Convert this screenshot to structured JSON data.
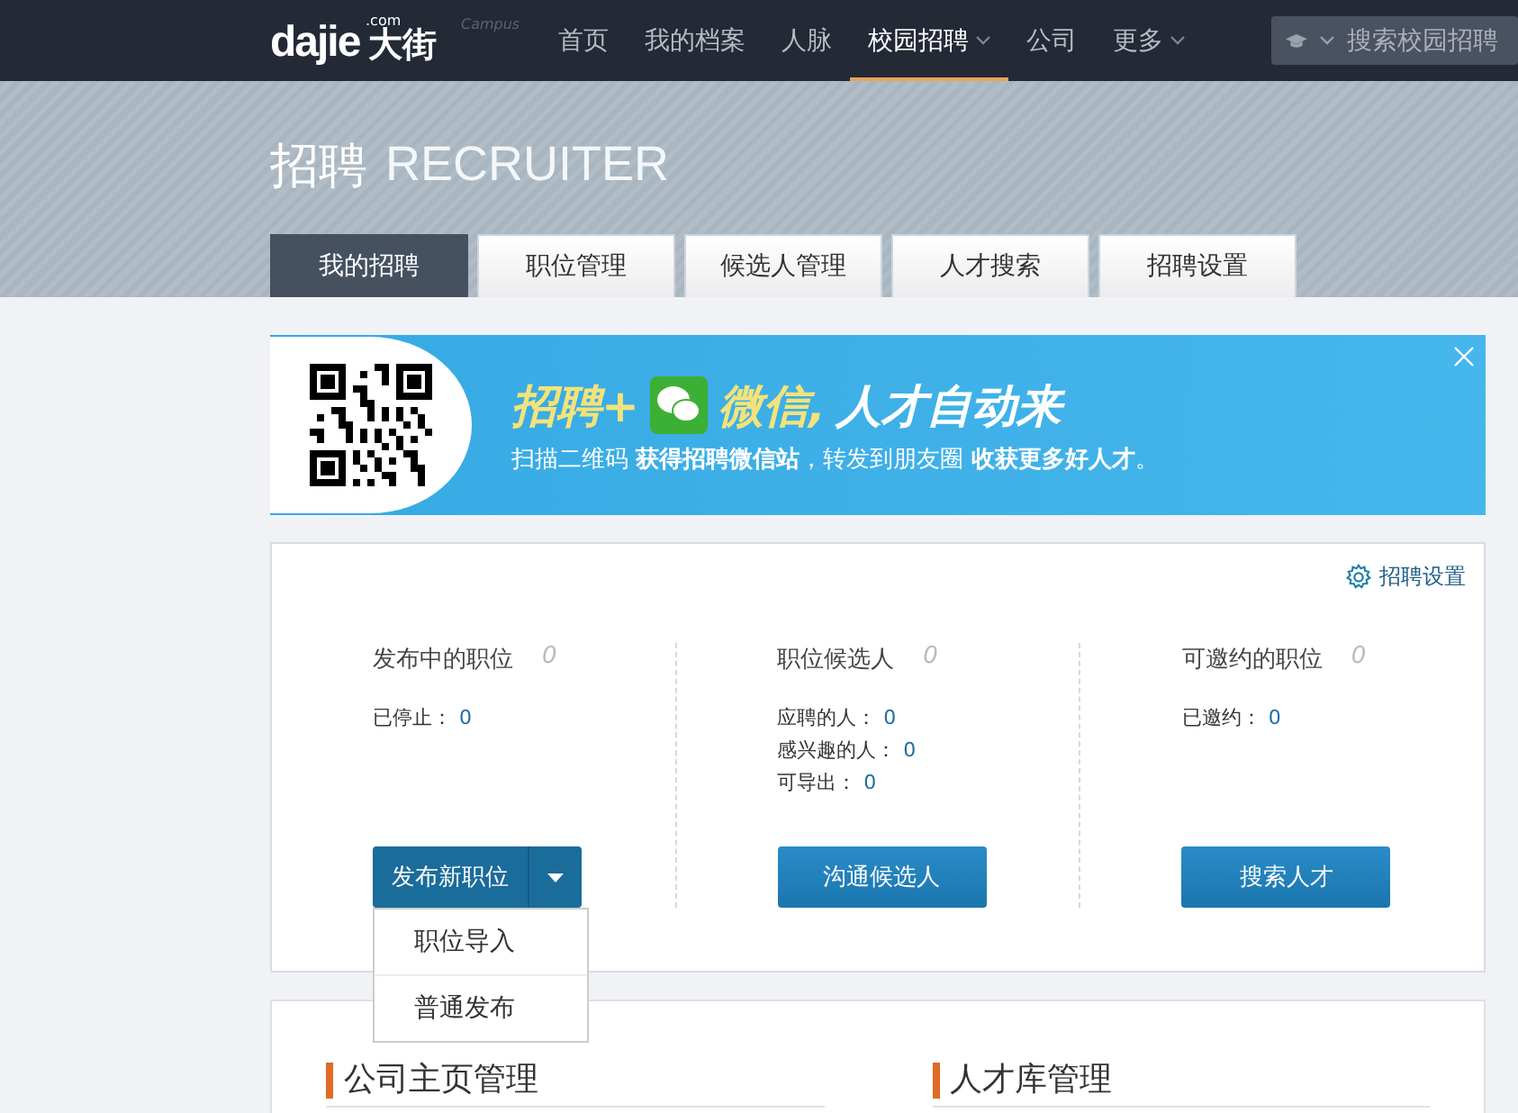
{
  "header": {
    "logo": {
      "brand": "dajie",
      "domain": ".com",
      "cjk": "大街",
      "tag": "Campus"
    },
    "nav": [
      {
        "label": "首页",
        "selected": false,
        "dropdown": false
      },
      {
        "label": "我的档案",
        "selected": false,
        "dropdown": false
      },
      {
        "label": "人脉",
        "selected": false,
        "dropdown": false
      },
      {
        "label": "校园招聘",
        "selected": true,
        "dropdown": true
      },
      {
        "label": "公司",
        "selected": false,
        "dropdown": false
      },
      {
        "label": "更多",
        "selected": false,
        "dropdown": true
      }
    ],
    "search": {
      "placeholder": "搜索校园招聘"
    }
  },
  "hero": {
    "title": "招聘",
    "subtitle": "RECRUITER"
  },
  "tabs": [
    {
      "label": "我的招聘",
      "selected": true
    },
    {
      "label": "职位管理",
      "selected": false
    },
    {
      "label": "候选人管理",
      "selected": false
    },
    {
      "label": "人才搜索",
      "selected": false
    },
    {
      "label": "招聘设置",
      "selected": false
    }
  ],
  "banner": {
    "headline_1": "招聘+",
    "headline_2": "微信,",
    "headline_3": "人才自动来",
    "text": "扫描二维码 **获得招聘微信站**，转发到朋友圈 **收获更多好人才**。"
  },
  "dashboard": {
    "settings_link": "招聘设置",
    "columns": [
      {
        "title": "发布中的职位",
        "count": "0",
        "stats": [
          {
            "label": "已停止：",
            "value": "0"
          }
        ],
        "button": {
          "label": "发布新职位",
          "dropdown": true
        }
      },
      {
        "title": "职位候选人",
        "count": "0",
        "stats": [
          {
            "label": "应聘的人：",
            "value": "0"
          },
          {
            "label": "感兴趣的人：",
            "value": "0"
          },
          {
            "label": "可导出：",
            "value": "0"
          }
        ],
        "button": {
          "label": "沟通候选人",
          "dropdown": false
        }
      },
      {
        "title": "可邀约的职位",
        "count": "0",
        "stats": [
          {
            "label": "已邀约：",
            "value": "0"
          }
        ],
        "button": {
          "label": "搜索人才",
          "dropdown": false
        }
      }
    ],
    "menu": [
      "职位导入",
      "普通发布"
    ]
  },
  "sections": [
    "公司主页管理",
    "人才库管理"
  ]
}
